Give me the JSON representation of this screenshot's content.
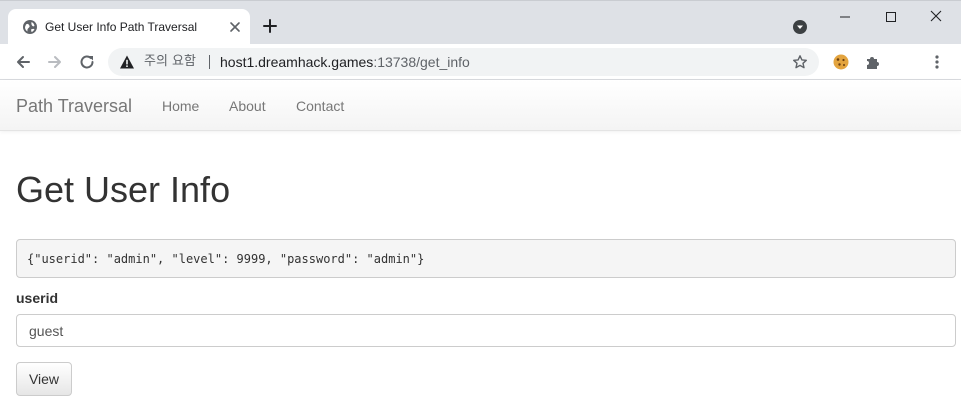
{
  "browser": {
    "tab_title": "Get User Info Path Traversal",
    "address": {
      "security_label": "주의 요함",
      "host": "host1.dreamhack.games",
      "path": ":13738/get_info"
    },
    "icons": {
      "tab": "globe-icon",
      "new_tab": "plus-icon",
      "back": "back-arrow-icon",
      "forward": "forward-arrow-icon",
      "reload": "reload-icon",
      "warning": "warning-icon",
      "bookmark": "star-icon",
      "extension_cookie": "cookie-icon",
      "extensions": "puzzle-icon",
      "menu": "kebab-menu-icon"
    }
  },
  "navbar": {
    "brand": "Path Traversal",
    "links": [
      {
        "label": "Home"
      },
      {
        "label": "About"
      },
      {
        "label": "Contact"
      }
    ]
  },
  "main": {
    "title": "Get User Info",
    "result": "{\"userid\": \"admin\", \"level\": 9999, \"password\": \"admin\"}",
    "form": {
      "label": "userid",
      "value": "guest",
      "button_label": "View"
    }
  }
}
